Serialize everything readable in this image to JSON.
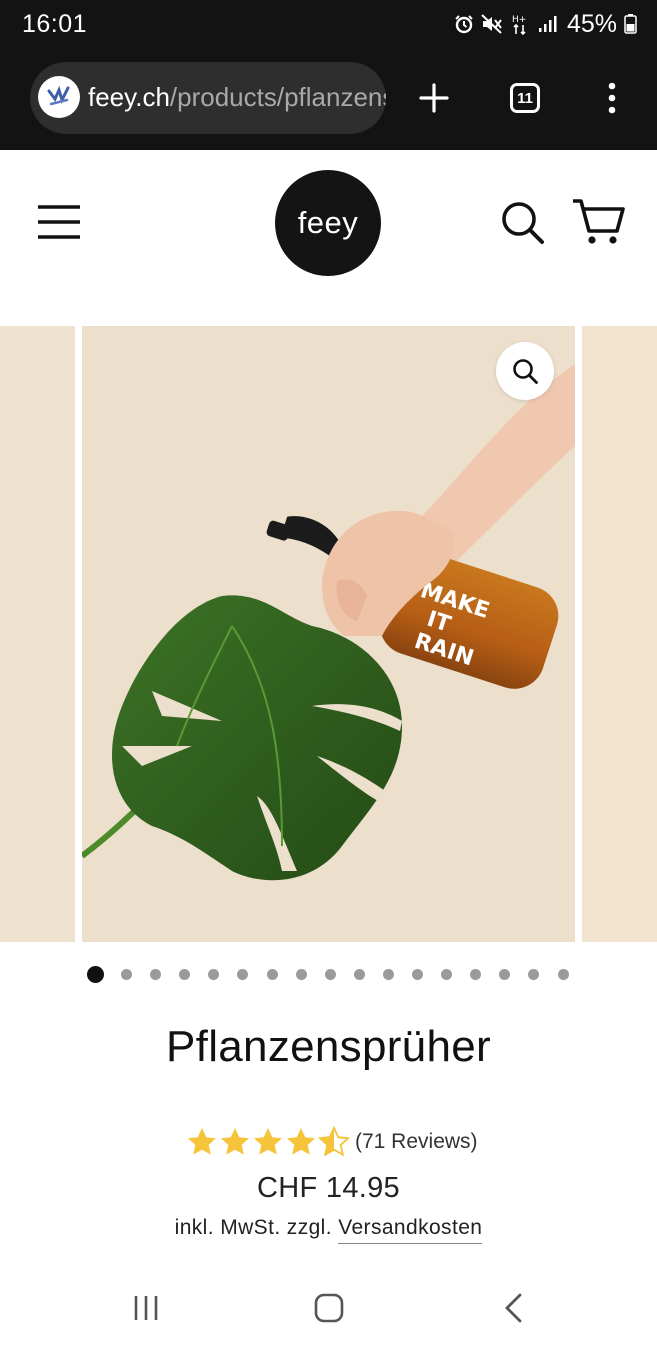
{
  "status_bar": {
    "time": "16:01",
    "battery": "45%",
    "icons": [
      "alarm-icon",
      "mute-icon",
      "data-icon",
      "signal-icon",
      "battery-icon"
    ]
  },
  "browser": {
    "url_domain": "feey.ch",
    "url_path": "/products/pflanzenspruher",
    "tab_count": "11",
    "icons": [
      "new-tab-icon",
      "tabs-icon",
      "menu-icon"
    ]
  },
  "site_header": {
    "logo_text": "feey",
    "icons": [
      "hamburger-menu-icon",
      "search-icon",
      "cart-icon"
    ]
  },
  "carousel": {
    "slide_count": 17,
    "active_index": 0,
    "bottle_text": [
      "MAKE",
      "IT",
      "RAIN"
    ],
    "colors": {
      "background": "#ecdfcb",
      "bottle": "#b8661b",
      "leaf": "#2f5d1e"
    }
  },
  "product": {
    "title": "Pflanzensprüher",
    "rating": 4.5,
    "reviews": "(71 Reviews)",
    "price": "CHF 14.95",
    "tax_prefix": "inkl. MwSt. zzgl.",
    "shipping_link": "Versandkosten"
  },
  "colors": {
    "star": "#f5c43a",
    "dark": "#131313"
  }
}
